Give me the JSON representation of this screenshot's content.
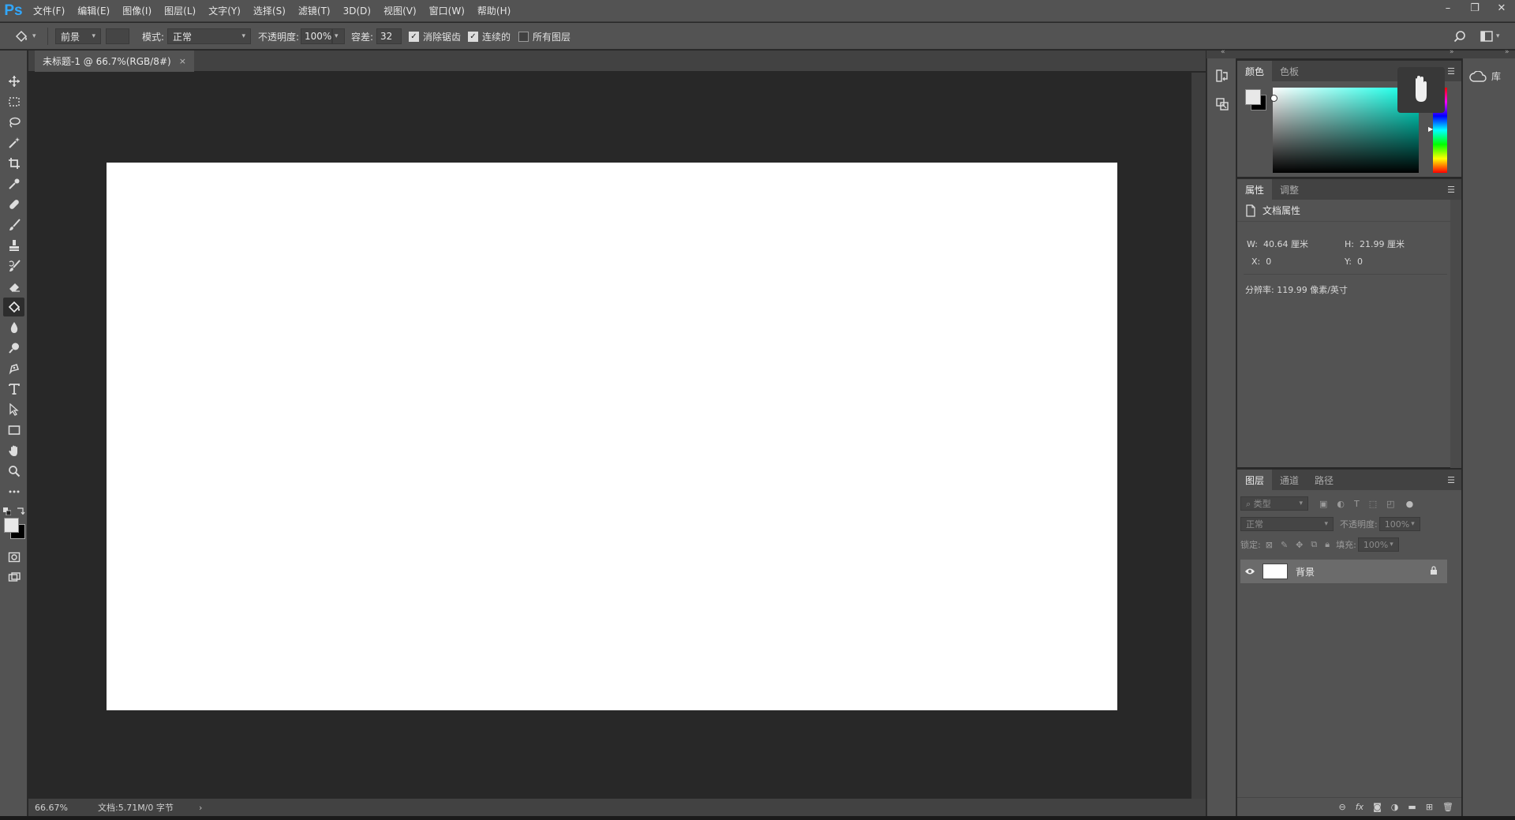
{
  "app": {
    "logo": "Ps"
  },
  "menu": [
    "文件(F)",
    "编辑(E)",
    "图像(I)",
    "图层(L)",
    "文字(Y)",
    "选择(S)",
    "滤镜(T)",
    "3D(D)",
    "视图(V)",
    "窗口(W)",
    "帮助(H)"
  ],
  "window_controls": {
    "minimize": "–",
    "restore": "❐",
    "close": "✕"
  },
  "options": {
    "fill_source": "前景",
    "mode_label": "模式:",
    "mode_value": "正常",
    "opacity_label": "不透明度:",
    "opacity_value": "100%",
    "tolerance_label": "容差:",
    "tolerance_value": "32",
    "antialias_label": "消除锯齿",
    "antialias_checked": true,
    "contiguous_label": "连续的",
    "contiguous_checked": true,
    "all_layers_label": "所有图层",
    "all_layers_checked": false
  },
  "document_tab": {
    "title": "未标题-1 @ 66.7%(RGB/8#)",
    "close": "×"
  },
  "status": {
    "zoom": "66.67%",
    "doc_info": "文档:5.71M/0 字节",
    "arrow": "›"
  },
  "color_panel": {
    "tabs": [
      "颜色",
      "色板"
    ],
    "active_tab": 0,
    "foreground": "#e8e8e8",
    "background": "#000000",
    "hue_color": "#00ffe4"
  },
  "properties_panel": {
    "tabs": [
      "属性",
      "调整"
    ],
    "active_tab": 0,
    "header": "文档属性",
    "w_label": "W:",
    "w_value": "40.64 厘米",
    "h_label": "H:",
    "h_value": "21.99 厘米",
    "x_label": "X:",
    "x_value": "0",
    "y_label": "Y:",
    "y_value": "0",
    "resolution": "分辨率: 119.99 像素/英寸"
  },
  "layers_panel": {
    "tabs": [
      "图层",
      "通道",
      "路径"
    ],
    "active_tab": 0,
    "filter_placeholder": "类型",
    "blend_mode": "正常",
    "opacity_label": "不透明度:",
    "opacity_value": "100%",
    "lock_label": "锁定:",
    "fill_label": "填充:",
    "fill_value": "100%",
    "layers": [
      {
        "name": "背景",
        "visible": true,
        "locked": true
      }
    ]
  },
  "library": {
    "label": "库"
  },
  "colors": {
    "accent": "#31a8ff",
    "ui_bg": "#535353",
    "canvas_bg": "#282828"
  }
}
